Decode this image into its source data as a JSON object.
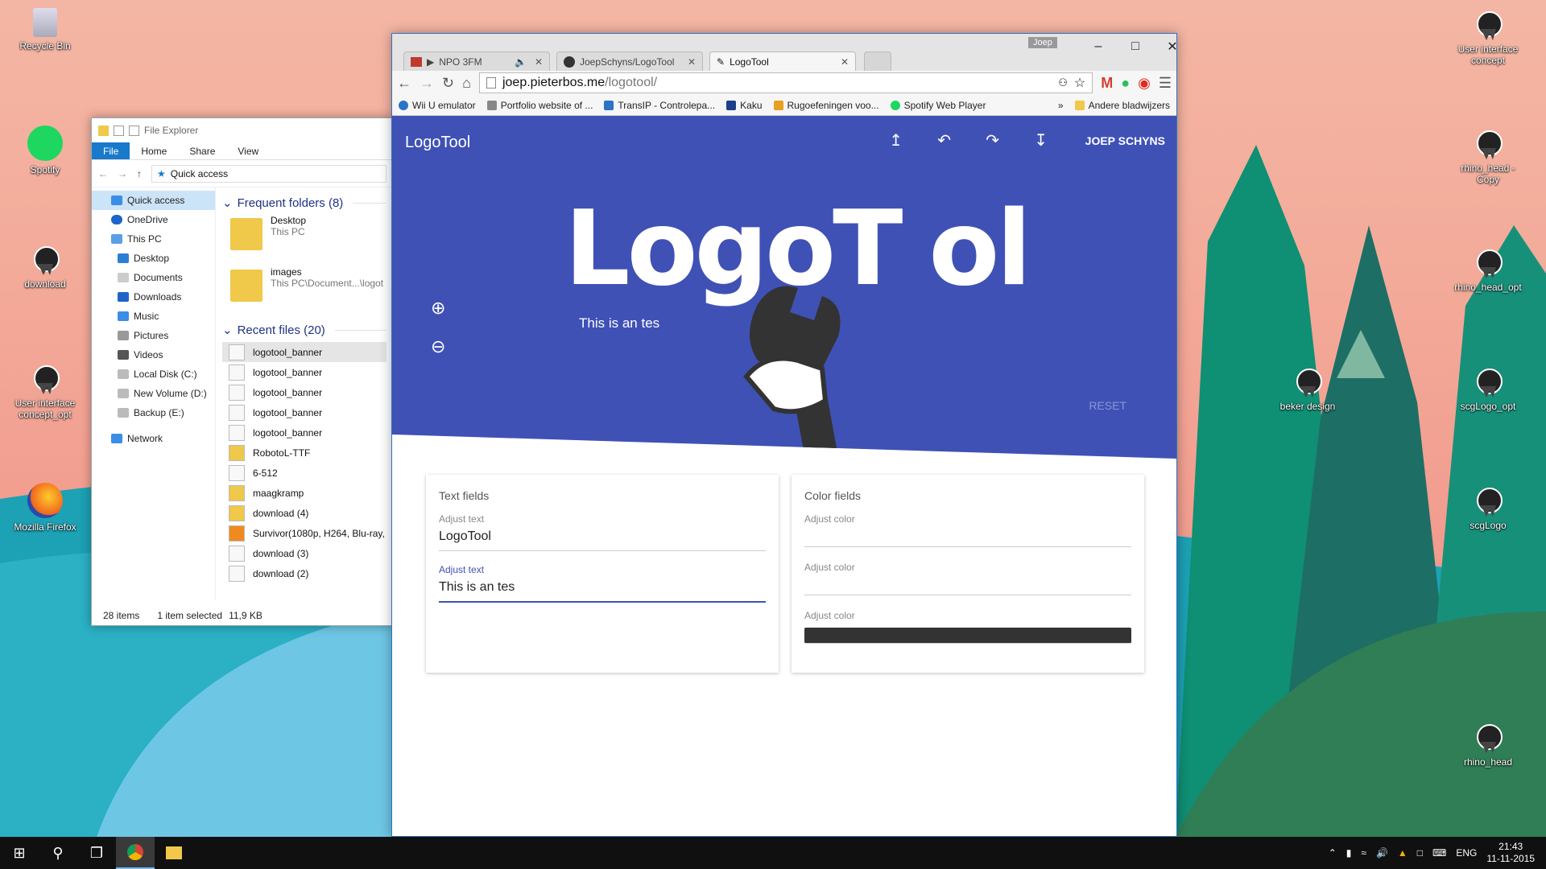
{
  "desktop": {
    "icons_left": [
      "Recycle Bin",
      "Spotify",
      "download",
      "User interface concept_opt",
      "Mozilla Firefox"
    ],
    "icons_right": [
      "User interface concept",
      "rhino_head - Copy",
      "rhino_head_opt",
      "scgLogo_opt",
      "beker design",
      "scgLogo",
      "rhino_head"
    ]
  },
  "explorer": {
    "title": "File Explorer",
    "ribbon": [
      "File",
      "Home",
      "Share",
      "View"
    ],
    "address": "Quick access",
    "nav": [
      "Quick access",
      "OneDrive",
      "This PC",
      "Desktop",
      "Documents",
      "Downloads",
      "Music",
      "Pictures",
      "Videos",
      "Local Disk (C:)",
      "New Volume (D:)",
      "Backup (E:)",
      "Network"
    ],
    "frequent_header": "Frequent folders (8)",
    "frequent": [
      {
        "name": "Desktop",
        "path": "This PC"
      },
      {
        "name": "images",
        "path": "This PC\\Document...\\logot"
      }
    ],
    "recent_header": "Recent files (20)",
    "recent": [
      "logotool_banner",
      "logotool_banner",
      "logotool_banner",
      "logotool_banner",
      "logotool_banner",
      "RobotoL-TTF",
      "6-512",
      "maagkramp",
      "download (4)",
      "Survivor(1080p, H264, Blu-ray,",
      "download (3)",
      "download (2)"
    ],
    "status": {
      "count": "28 items",
      "selected": "1 item selected",
      "size": "11,9 KB"
    }
  },
  "chrome": {
    "user": "Joep",
    "tabs": [
      "NPO 3FM",
      "JoepSchyns/LogoTool",
      "LogoTool"
    ],
    "url_host": "joep.pieterbos.me",
    "url_path": "/logotool/",
    "bookmarks": [
      "Wii U emulator",
      "Portfolio website of ...",
      "TransIP - Controlepa...",
      "Kaku",
      "Rugoefeningen voo...",
      "Spotify Web Player"
    ],
    "bookmarks_more": "»",
    "other_bookmarks": "Andere bladwijzers"
  },
  "app": {
    "title": "LogoTool",
    "user": "JOEP SCHYNS",
    "logo_text_a": "LogoT",
    "logo_text_b": "ol",
    "subtitle": "This is an tes",
    "reset": "RESET",
    "text_card": {
      "title": "Text fields",
      "fields": [
        {
          "label": "Adjust text",
          "value": "LogoTool"
        },
        {
          "label": "Adjust text",
          "value": "This is an tes"
        }
      ]
    },
    "color_card": {
      "title": "Color fields",
      "fields": [
        {
          "label": "Adjust color",
          "value": ""
        },
        {
          "label": "Adjust color",
          "value": ""
        },
        {
          "label": "Adjust color",
          "value": "#333333"
        }
      ]
    }
  },
  "colors": {
    "primary": "#3f51b5",
    "accent_blue": "#1979ca"
  },
  "taskbar": {
    "lang": "ENG",
    "time": "21:43",
    "date": "11-11-2015"
  }
}
